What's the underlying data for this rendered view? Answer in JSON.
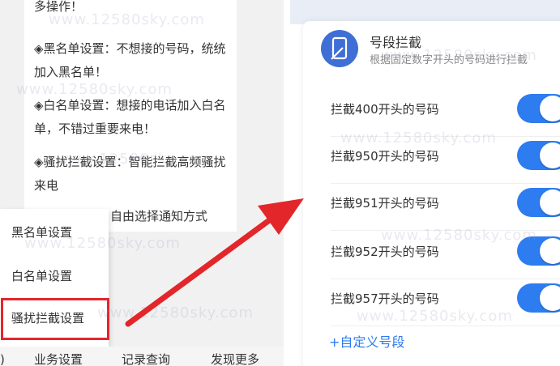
{
  "left_panel": {
    "help_lines": [
      "多操作！",
      "◈黑名单设置：不想接的号码，统统加入黑名单！",
      "◈白名单设置：想接的电话加入白名单，不错过重要来电！",
      "◈骚扰拦截设置：智能拦截高频骚扰来电"
    ],
    "help_extra": "自由选择通知方式",
    "menu_items": [
      "黑名单设置",
      "白名单设置",
      "骚扰拦截设置"
    ],
    "highlighted_item_color": "#e3262a",
    "bottom_nav": {
      "edge_glyph": ")",
      "items": [
        "业务设置",
        "记录查询",
        "发现更多"
      ]
    }
  },
  "right_panel": {
    "feature": {
      "icon": "phone-icon",
      "title": "号段拦截",
      "subtitle": "根据固定数字开头的号码进行拦截"
    },
    "rules": [
      {
        "label": "拦截400开头的号码",
        "enabled": true
      },
      {
        "label": "拦截950开头的号码",
        "enabled": true
      },
      {
        "label": "拦截951开头的号码",
        "enabled": true
      },
      {
        "label": "拦截952开头的号码",
        "enabled": true
      },
      {
        "label": "拦截957开头的号码",
        "enabled": true
      }
    ],
    "custom_link": "+自定义号段",
    "accent_color": "#2d7cf0"
  },
  "watermark_text": "www.12580sky.com",
  "annotation": {
    "arrow_color": "#e3262a"
  }
}
